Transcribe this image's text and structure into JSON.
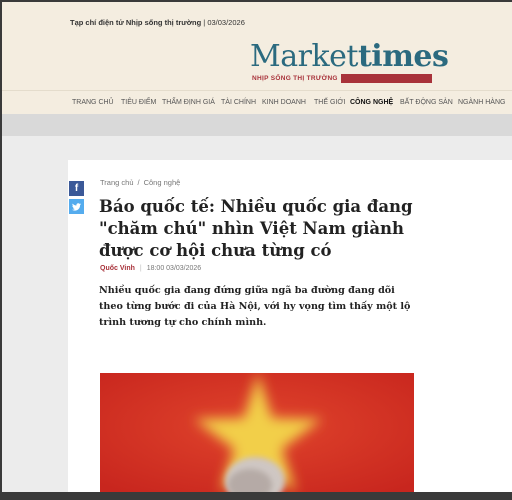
{
  "topbar": {
    "label": "Tạp chí điện tử Nhịp sống thị trường",
    "date": "03/03/2026"
  },
  "logo": {
    "market": "Market",
    "times": "times",
    "tagline": "NHỊP SỐNG THỊ TRƯỜNG"
  },
  "nav": {
    "items": [
      "TRANG CHỦ",
      "TIÊU ĐIỂM",
      "THẨM ĐỊNH GIÁ",
      "TÀI CHÍNH",
      "KINH DOANH",
      "THẾ GIỚI",
      "CÔNG NGHỆ",
      "BẤT ĐỘNG SẢN",
      "NGÀNH HÀNG"
    ],
    "active": "CÔNG NGHỆ"
  },
  "breadcrumb": {
    "home": "Trang chủ",
    "separator": "/",
    "category": "Công nghệ"
  },
  "article": {
    "title": "Báo quốc tế: Nhiều quốc gia đang \"chăm chú\" nhìn Việt Nam giành được cơ hội chưa từng có",
    "author": "Quốc Vinh",
    "time": "18:00 03/03/2026",
    "sapo": "Nhiều quốc gia đang đứng giữa ngã ba đường đang dõi theo từng bước đi của Hà Nội, với hy vọng tìm thấy một lộ trình tương tự cho chính mình."
  },
  "share": {
    "facebook_icon": "facebook-icon",
    "twitter_icon": "twitter-icon"
  },
  "colors": {
    "brand_teal": "#2b6a7f",
    "brand_red": "#a8323a",
    "header_bg": "#f4ede0",
    "facebook": "#3b5998",
    "twitter": "#55acee"
  }
}
